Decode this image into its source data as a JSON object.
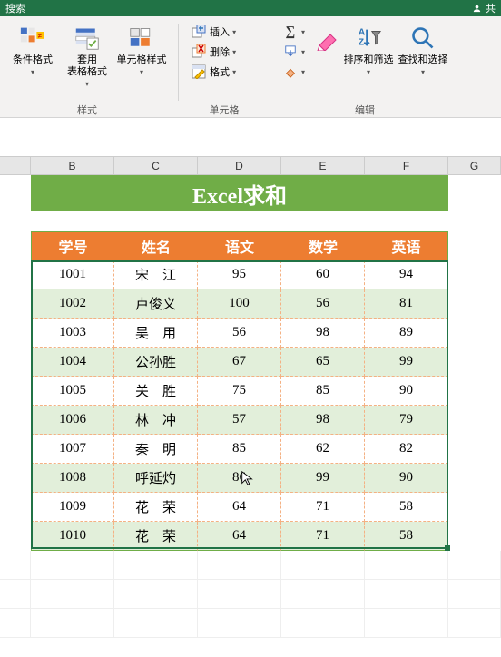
{
  "titlebar": {
    "search_hint": "搜索",
    "share_hint": "共"
  },
  "ribbon": {
    "groups": {
      "styles": {
        "label": "样式",
        "cond_format": "条件格式",
        "table_format": "套用\n表格格式",
        "cell_style": "单元格样式"
      },
      "cells": {
        "label": "单元格",
        "insert": "插入",
        "delete": "删除",
        "format": "格式"
      },
      "editing": {
        "label": "编辑",
        "sort_filter": "排序和筛选",
        "find_select": "查找和选择"
      }
    }
  },
  "columns": [
    "B",
    "C",
    "D",
    "E",
    "F",
    "G"
  ],
  "title": "Excel求和",
  "headers": [
    "学号",
    "姓名",
    "语文",
    "数学",
    "英语"
  ],
  "rows": [
    {
      "id": "1001",
      "name": "宋　江",
      "c": "95",
      "d": "60",
      "e": "94"
    },
    {
      "id": "1002",
      "name": "卢俊义",
      "c": "100",
      "d": "56",
      "e": "81"
    },
    {
      "id": "1003",
      "name": "吴　用",
      "c": "56",
      "d": "98",
      "e": "89"
    },
    {
      "id": "1004",
      "name": "公孙胜",
      "c": "67",
      "d": "65",
      "e": "99"
    },
    {
      "id": "1005",
      "name": "关　胜",
      "c": "75",
      "d": "85",
      "e": "90"
    },
    {
      "id": "1006",
      "name": "林　冲",
      "c": "57",
      "d": "98",
      "e": "79"
    },
    {
      "id": "1007",
      "name": "秦　明",
      "c": "85",
      "d": "62",
      "e": "82"
    },
    {
      "id": "1008",
      "name": "呼延灼",
      "c": "86",
      "d": "99",
      "e": "90"
    },
    {
      "id": "1009",
      "name": "花　荣",
      "c": "64",
      "d": "71",
      "e": "58"
    },
    {
      "id": "1010",
      "name": "花　荣",
      "c": "64",
      "d": "71",
      "e": "58"
    }
  ],
  "chart_data": {
    "type": "table",
    "title": "Excel求和",
    "columns": [
      "学号",
      "姓名",
      "语文",
      "数学",
      "英语"
    ],
    "rows": [
      [
        "1001",
        "宋江",
        95,
        60,
        94
      ],
      [
        "1002",
        "卢俊义",
        100,
        56,
        81
      ],
      [
        "1003",
        "吴用",
        56,
        98,
        89
      ],
      [
        "1004",
        "公孙胜",
        67,
        65,
        99
      ],
      [
        "1005",
        "关胜",
        75,
        85,
        90
      ],
      [
        "1006",
        "林冲",
        57,
        98,
        79
      ],
      [
        "1007",
        "秦明",
        85,
        62,
        82
      ],
      [
        "1008",
        "呼延灼",
        86,
        99,
        90
      ],
      [
        "1009",
        "花荣",
        64,
        71,
        58
      ],
      [
        "1010",
        "花荣",
        64,
        71,
        58
      ]
    ]
  }
}
